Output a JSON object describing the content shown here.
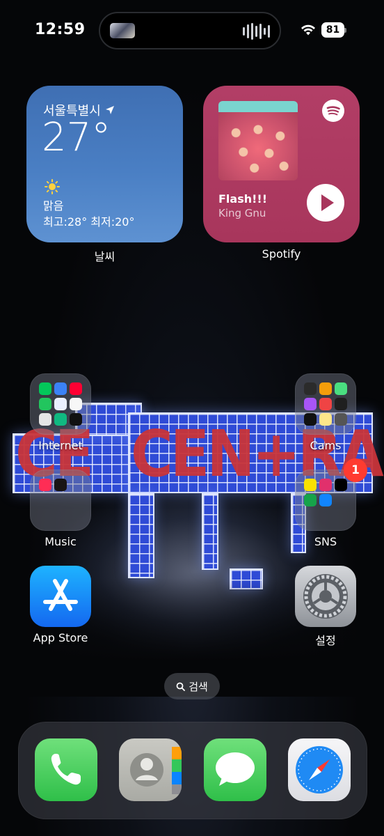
{
  "status_bar": {
    "time": "12:59",
    "battery_level": "81"
  },
  "widgets": {
    "weather": {
      "city": "서울특별시",
      "temperature": "27°",
      "condition": "맑음",
      "hi_lo": "최고:28° 최저:20°",
      "caption": "날씨"
    },
    "spotify": {
      "track": "Flash!!!",
      "artist": "King Gnu",
      "caption": "Spotify",
      "background_color": "#a8365c"
    }
  },
  "apps": {
    "internet": {
      "label": "Internet"
    },
    "cams": {
      "label": "Cams"
    },
    "music": {
      "label": "Music"
    },
    "sns": {
      "label": "SNS",
      "badge": "1"
    },
    "app_store": {
      "label": "App Store"
    },
    "settings": {
      "label": "설정"
    }
  },
  "search": {
    "label": "검색"
  },
  "dock": {
    "items": [
      "phone-icon",
      "contacts-icon",
      "messages-icon",
      "safari-icon"
    ]
  },
  "colors": {
    "badge": "#ff3b30",
    "weather_widget": "#4a7fc4",
    "stage_grid": "#2f4bd6"
  }
}
